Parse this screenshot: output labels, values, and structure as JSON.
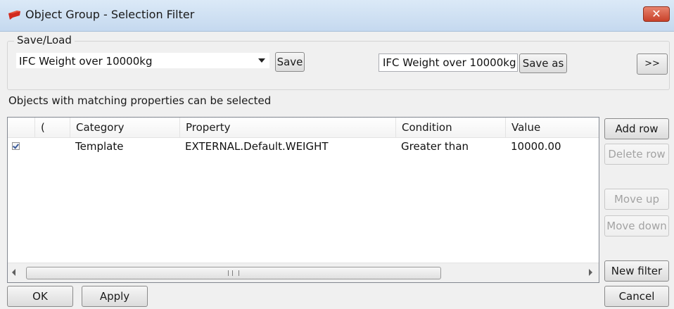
{
  "window": {
    "title": "Object Group - Selection Filter",
    "close_label": "✕"
  },
  "save_load": {
    "group_label": "Save/Load",
    "selected_filter": "IFC Weight over 10000kg",
    "save_label": "Save",
    "save_as_name": "IFC Weight over 10000kg",
    "save_as_label": "Save as",
    "expand_label": ">>"
  },
  "filter": {
    "description": "Objects with matching properties can be selected",
    "columns": [
      "(",
      "Category",
      "Property",
      "Condition",
      "Value"
    ],
    "rows": [
      {
        "enabled": true,
        "paren": "",
        "category": "Template",
        "property": "EXTERNAL.Default.WEIGHT",
        "condition": "Greater than",
        "value": "10000.00"
      }
    ]
  },
  "side_buttons": {
    "add_row": "Add row",
    "delete_row": "Delete row",
    "move_up": "Move up",
    "move_down": "Move down",
    "new_filter": "New filter"
  },
  "footer": {
    "ok": "OK",
    "apply": "Apply",
    "cancel": "Cancel"
  },
  "colors": {
    "close_button": "#c8412a",
    "app_icon": "#d12a1e",
    "checkmark": "#3a5a9b"
  }
}
